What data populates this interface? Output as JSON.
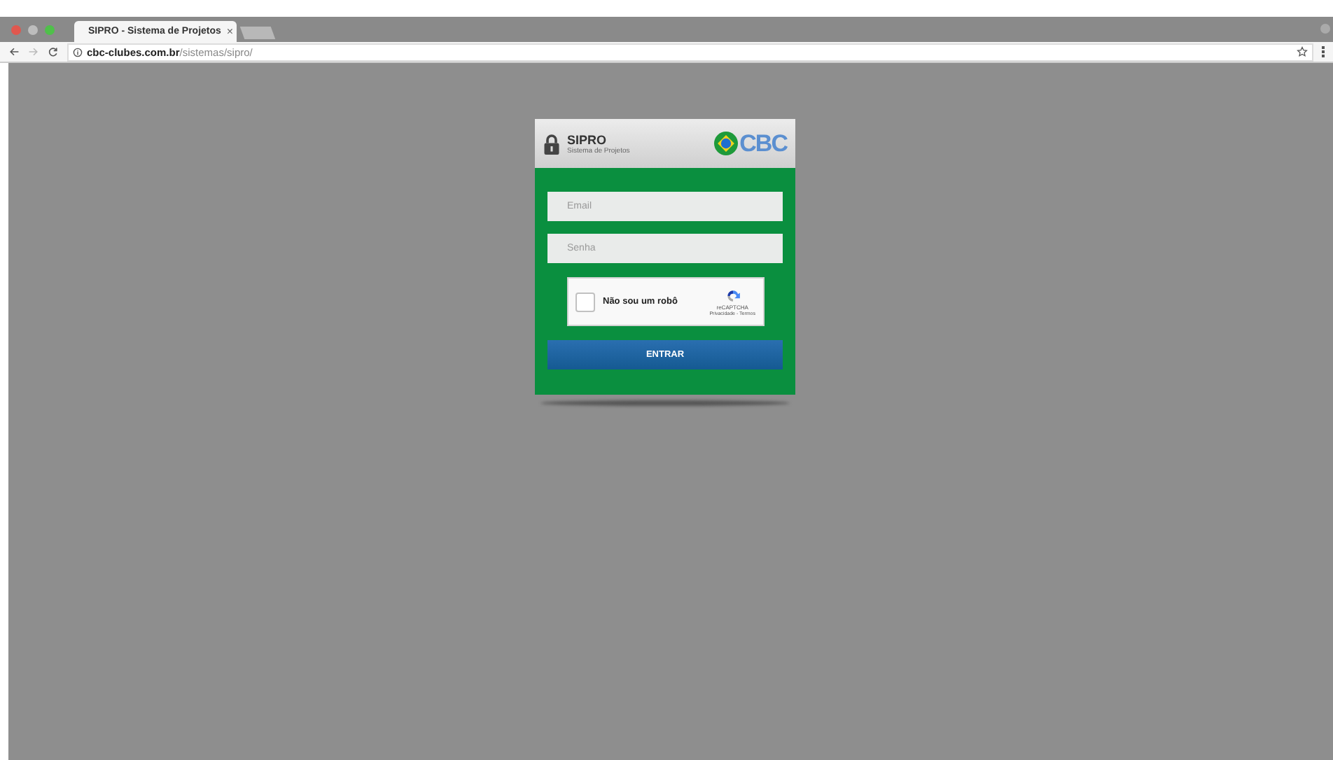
{
  "browser": {
    "tab_title": "SIPRO - Sistema de Projetos",
    "tab_close": "×",
    "url_host": "cbc-clubes.com.br",
    "url_path": "/sistemas/sipro/"
  },
  "login": {
    "title": "SIPRO",
    "subtitle": "Sistema de Projetos",
    "logo_text": "CBC",
    "email": {
      "placeholder": "Email"
    },
    "password": {
      "placeholder": "Senha"
    },
    "captcha": {
      "label": "Não sou um robô",
      "checked": false,
      "brand": "reCAPTCHA",
      "links": "Privacidade - Termos"
    },
    "submit": "ENTRAR"
  }
}
